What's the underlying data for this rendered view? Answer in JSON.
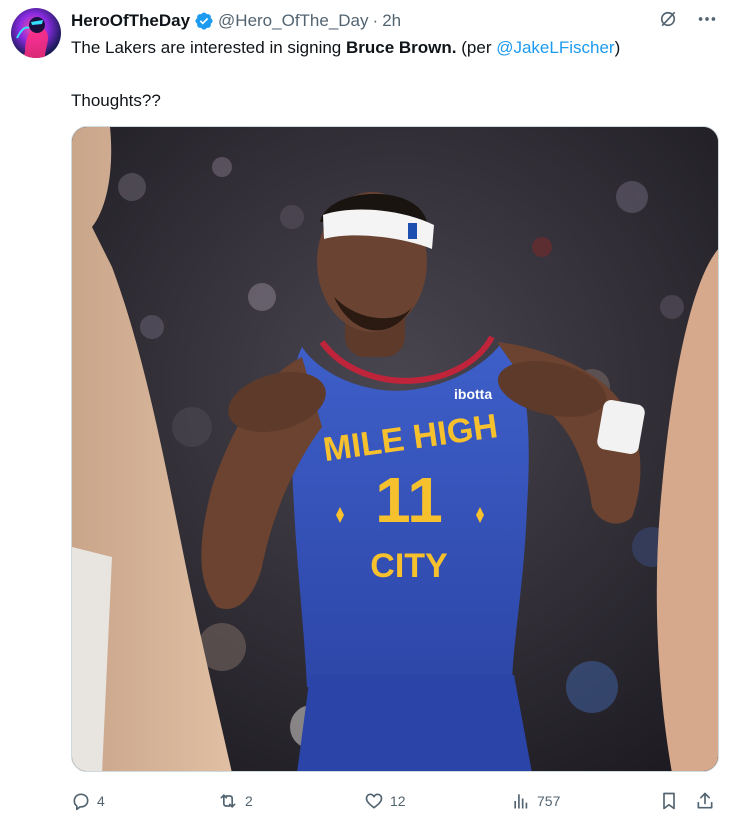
{
  "tweet": {
    "display_name": "HeroOfTheDay",
    "handle": "@Hero_OfThe_Day",
    "separator": "·",
    "time": "2h",
    "text_part1": "The Lakers are interested in signing ",
    "text_bold": "Bruce Brown.",
    "text_part2": " (per ",
    "text_mention": "@JakeLFischer",
    "text_part3": ")",
    "text_line2": "Thoughts??",
    "image_jersey_text": "MILE HIGH",
    "image_jersey_number": "11",
    "image_jersey_city": "CITY",
    "image_sponsor": "ibotta"
  },
  "actions": {
    "replies": "4",
    "reposts": "2",
    "likes": "12",
    "views": "757"
  },
  "icons": {
    "verified": "verified-badge-icon",
    "grok": "grok-icon",
    "more": "more-icon",
    "reply": "reply-icon",
    "repost": "repost-icon",
    "like": "heart-icon",
    "views": "views-icon",
    "bookmark": "bookmark-icon",
    "share": "share-icon"
  },
  "colors": {
    "accent": "#1d9bf0",
    "muted": "#536471",
    "text": "#0f1419"
  }
}
